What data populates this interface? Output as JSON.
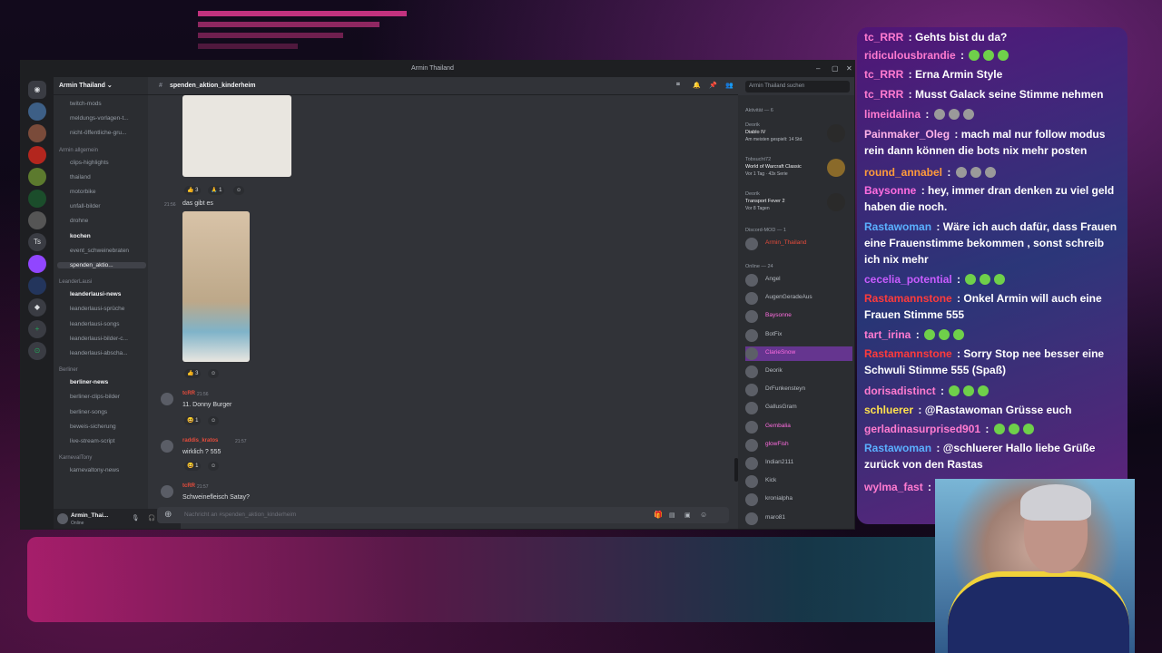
{
  "window": {
    "title": "Armin Thailand"
  },
  "server": {
    "name": "Armin Thailand ⌄"
  },
  "channel_header": {
    "name": "spenden_aktion_kinderheim",
    "search_placeholder": "Armin Thailand suchen"
  },
  "channels": [
    {
      "label": "twitch-mods",
      "style": "normal"
    },
    {
      "label": "meldungs-vorlagen-t...",
      "style": "normal"
    },
    {
      "label": "nicht-öffentliche-gru...",
      "style": "normal"
    },
    {
      "label": "Armin allgemein",
      "style": "category"
    },
    {
      "label": "clips-highlights",
      "style": "normal"
    },
    {
      "label": "thailand",
      "style": "normal"
    },
    {
      "label": "motorbike",
      "style": "normal"
    },
    {
      "label": "unfall-bilder",
      "style": "normal"
    },
    {
      "label": "drohne",
      "style": "normal"
    },
    {
      "label": "kochen",
      "style": "bold"
    },
    {
      "label": "event_schweinebraten",
      "style": "normal"
    },
    {
      "label": "spenden_aktio...",
      "style": "active"
    },
    {
      "label": "LeanderLausi",
      "style": "category"
    },
    {
      "label": "leanderlausi-news",
      "style": "bold"
    },
    {
      "label": "leanderlausi-sprüche",
      "style": "normal"
    },
    {
      "label": "leanderlausi-songs",
      "style": "normal"
    },
    {
      "label": "leanderlausi-bilder-c...",
      "style": "normal"
    },
    {
      "label": "leanderlausi-abscha...",
      "style": "normal"
    },
    {
      "label": "Berliner",
      "style": "category"
    },
    {
      "label": "berliner-news",
      "style": "bold"
    },
    {
      "label": "berliner-clips-bilder",
      "style": "normal"
    },
    {
      "label": "berliner-songs",
      "style": "normal"
    },
    {
      "label": "beweis-sicherung",
      "style": "normal"
    },
    {
      "label": "live-stream-script",
      "style": "normal"
    },
    {
      "label": "KarnevalTony",
      "style": "category"
    },
    {
      "label": "karnevaltony-news",
      "style": "normal"
    }
  ],
  "user": {
    "name": "Armin_Thai...",
    "status": "Online"
  },
  "messages": [
    {
      "time": "21:56",
      "text": "das gibt es"
    },
    {
      "user": "tcRR",
      "time": "21:56",
      "text": "11. Donny Burger"
    },
    {
      "user": "raddis_kratos",
      "time": "21:57",
      "text": "wirklich ? 555"
    },
    {
      "user": "tcRR",
      "time": "21:57",
      "text": "Schweinefleisch Satay?"
    }
  ],
  "reactions": {
    "r1a": "👍 3",
    "r1b": "🙏 1",
    "r2": "👍 3",
    "r3": "😆 1",
    "r4": "😆 1"
  },
  "composer": {
    "placeholder": "Nachricht an #spenden_aktion_kinderheim"
  },
  "members": {
    "activity_header": "Aktivität — 6",
    "activities": [
      {
        "user": "Deorik",
        "game": "Diablo IV",
        "detail": "Am meisten gespielt: 14 Std."
      },
      {
        "user": "Tobsucht72",
        "game": "World of Warcraft Classic",
        "detail": "Vor 1 Tag · 43x Serie"
      },
      {
        "user": "Deorik",
        "game": "Transport Fever 2",
        "detail": "Vor 8 Tagen"
      }
    ],
    "mod_header": "Discord-MOD — 1",
    "mod": "Armin_Thailand",
    "online_header": "Online — 24",
    "online": [
      "Angel",
      "AugenGeradeAus",
      "Baysonne",
      "BotFix",
      "ClarieSnow",
      "Deorik",
      "DrFunkensteyn",
      "GallusGram",
      "Gembalia",
      "glowFish",
      "Indian2111",
      "Kick",
      "kronialpha",
      "maro81"
    ]
  },
  "chat_overlay": [
    {
      "user": "tc_RRR",
      "color": "#ff7bd0",
      "text": "Gehts bist du da?"
    },
    {
      "user": "ridiculousbrandie",
      "color": "#ff7bd0",
      "text": ""
    },
    {
      "user": "tc_RRR",
      "color": "#ff7bd0",
      "text": "Erna Armin Style"
    },
    {
      "user": "tc_RRR",
      "color": "#ff7bd0",
      "text": "Musst Galack seine Stimme nehmen"
    },
    {
      "user": "limeidalina",
      "color": "#ff7bd0",
      "text": ""
    },
    {
      "user": "Painmaker_Oleg",
      "color": "#ffb3e8",
      "text": "mach mal nur follow modus rein dann können die bots nix mehr posten"
    },
    {
      "user": "round_annabel",
      "color": "#ff9b3b",
      "text": ""
    },
    {
      "user": "Baysonne",
      "color": "#ff6de0",
      "text": "hey, immer dran denken zu viel geld haben die noch."
    },
    {
      "user": "Rastawoman",
      "color": "#5ab0ff",
      "text": "Wäre ich auch dafür, dass Frauen eine Frauenstimme bekommen , sonst schreib ich nix mehr"
    },
    {
      "user": "cecelia_potential",
      "color": "#c95cff",
      "text": ""
    },
    {
      "user": "Rastamannstone",
      "color": "#ff3b3b",
      "text": "Onkel Armin will auch eine Frauen Stimme 555"
    },
    {
      "user": "tart_irina",
      "color": "#ff7bd0",
      "text": ""
    },
    {
      "user": "Rastamannstone",
      "color": "#ff3b3b",
      "text": "Sorry Stop nee besser eine Schwuli Stimme 555 (Spaß)"
    },
    {
      "user": "dorisadistinct",
      "color": "#ff7bd0",
      "text": ""
    },
    {
      "user": "schluerer",
      "color": "#ffe14d",
      "text": "@Rastawoman Grüsse euch"
    },
    {
      "user": "gerladinasurprised901",
      "color": "#ff7bd0",
      "text": ""
    },
    {
      "user": "Rastawoman",
      "color": "#5ab0ff",
      "text": "@schluerer Hallo liebe Grüße zurück von den Rastas"
    },
    {
      "user": "wylma_fast",
      "color": "#ff7bd0",
      "text": ""
    }
  ]
}
